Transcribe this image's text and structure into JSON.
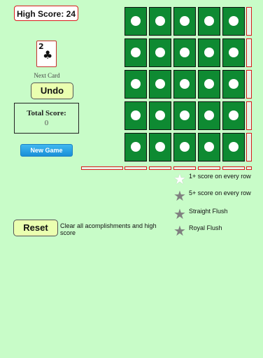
{
  "header": {
    "high_score_label": "High Score: 24"
  },
  "next_card": {
    "rank": "2",
    "suit": "♣",
    "label": "Next Card"
  },
  "controls": {
    "undo_label": "Undo",
    "new_game_label": "New Game",
    "reset_label": "Reset",
    "reset_description": "Clear all acomplishments and high score"
  },
  "score": {
    "total_label": "Total Score:",
    "total_value": "0"
  },
  "board": {
    "rows": 5,
    "cols": 5
  },
  "achievements": [
    {
      "label": "1+ score on every row",
      "star_color": "#ffffff"
    },
    {
      "label": "5+ score on every row",
      "star_color": "#808080"
    },
    {
      "label": "Straight Flush",
      "star_color": "#808080"
    },
    {
      "label": "Royal Flush",
      "star_color": "#808080"
    }
  ],
  "colors": {
    "background": "#c8fcc8",
    "cell": "#0e8a32",
    "accent_border": "#d81b1b"
  }
}
